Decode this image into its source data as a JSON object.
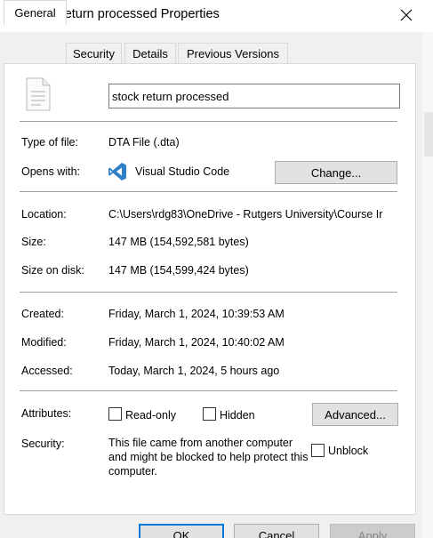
{
  "window": {
    "title": "stock return processed Properties",
    "close_glyph": "✕"
  },
  "tabs": [
    {
      "label": "General",
      "active": true
    },
    {
      "label": "Security",
      "active": false
    },
    {
      "label": "Details",
      "active": false
    },
    {
      "label": "Previous Versions",
      "active": false
    }
  ],
  "general": {
    "file_name": "stock return processed",
    "type_label": "Type of file:",
    "type_value": "DTA File (.dta)",
    "opens_label": "Opens with:",
    "opens_value": "Visual Studio Code",
    "change_button": "Change...",
    "location_label": "Location:",
    "location_value": "C:\\Users\\rdg83\\OneDrive - Rutgers University\\Course Ir",
    "size_label": "Size:",
    "size_value": "147 MB (154,592,581 bytes)",
    "size_on_disk_label": "Size on disk:",
    "size_on_disk_value": "147 MB (154,599,424 bytes)",
    "created_label": "Created:",
    "created_value": "Friday, March 1, 2024, 10:39:53 AM",
    "modified_label": "Modified:",
    "modified_value": "Friday, March 1, 2024, 10:40:02 AM",
    "accessed_label": "Accessed:",
    "accessed_value": "Today, March 1, 2024, 5 hours ago",
    "attributes_label": "Attributes:",
    "readonly_label": "Read-only",
    "readonly_checked": false,
    "hidden_label": "Hidden",
    "hidden_checked": false,
    "advanced_button": "Advanced...",
    "security_label": "Security:",
    "security_text": "This file came from another computer and might be blocked to help protect this computer.",
    "unblock_label": "Unblock",
    "unblock_checked": false
  },
  "footer": {
    "ok": "OK",
    "cancel": "Cancel",
    "apply": "Apply"
  },
  "colors": {
    "accent": "#0078d7",
    "vscode_blue": "#2f80c9",
    "panel_bg": "#ffffff",
    "window_bg": "#f0f0f0"
  }
}
